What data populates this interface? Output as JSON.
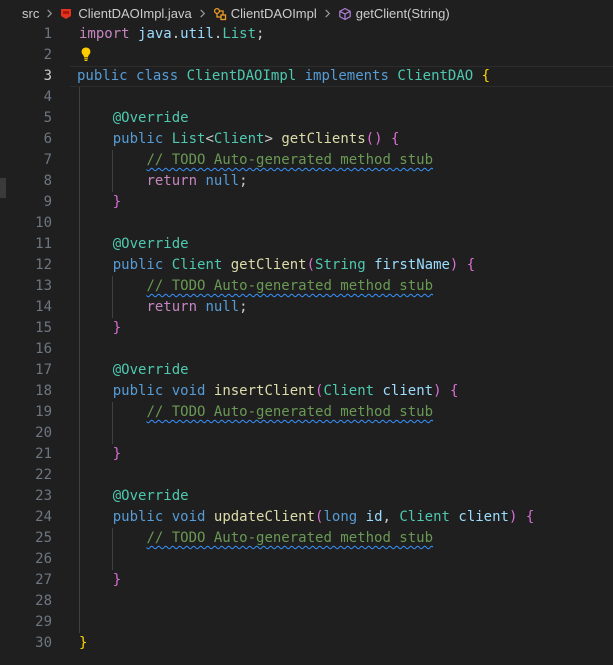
{
  "breadcrumb": {
    "folder": "src",
    "file": "ClientDAOImpl.java",
    "class_name": "ClientDAOImpl",
    "method": "getClient(String)",
    "icons": [
      "chevron-right-icon",
      "java-file-icon",
      "class-icon",
      "method-icon"
    ]
  },
  "editor": {
    "language": "java",
    "active_line": 3,
    "lightbulb_line": 2,
    "colors": {
      "background": "#1f1f1f",
      "keyword": "#569cd6",
      "control": "#c586c0",
      "type": "#4ec9b0",
      "function": "#dcdcaa",
      "variable": "#9cdcfe",
      "comment": "#6a9955",
      "bracket1": "#ffd700",
      "bracket2": "#da70d6",
      "bracket3": "#179fff",
      "warning_underline": "#3794ff"
    },
    "line_numbers": [
      "1",
      "2",
      "3",
      "4",
      "5",
      "6",
      "7",
      "8",
      "9",
      "10",
      "11",
      "12",
      "13",
      "14",
      "15",
      "16",
      "17",
      "18",
      "19",
      "20",
      "21",
      "22",
      "23",
      "24",
      "25",
      "26",
      "27",
      "28",
      "29",
      "30"
    ],
    "tokens": {
      "import": "import",
      "java": "java",
      "util": "util",
      "List": "List",
      "dot": ".",
      "semi": ";",
      "public": "public",
      "class": "class",
      "ClientDAOImpl": "ClientDAOImpl",
      "implements": "implements",
      "ClientDAO": "ClientDAO",
      "lbrace": "{",
      "rbrace": "}",
      "lparen": "(",
      "rparen": ")",
      "comma": ",",
      "at_override": "@Override",
      "lt": "<",
      "gt": ">",
      "Client": "Client",
      "getClients": "getClients",
      "todo_comment": "// TODO Auto-generated method stub",
      "return": "return",
      "null": "null",
      "getClient": "getClient",
      "String": "String",
      "firstName": "firstName",
      "void": "void",
      "insertClient": "insertClient",
      "client": "client",
      "updateClient": "updateClient",
      "long": "long",
      "id": "id"
    }
  }
}
